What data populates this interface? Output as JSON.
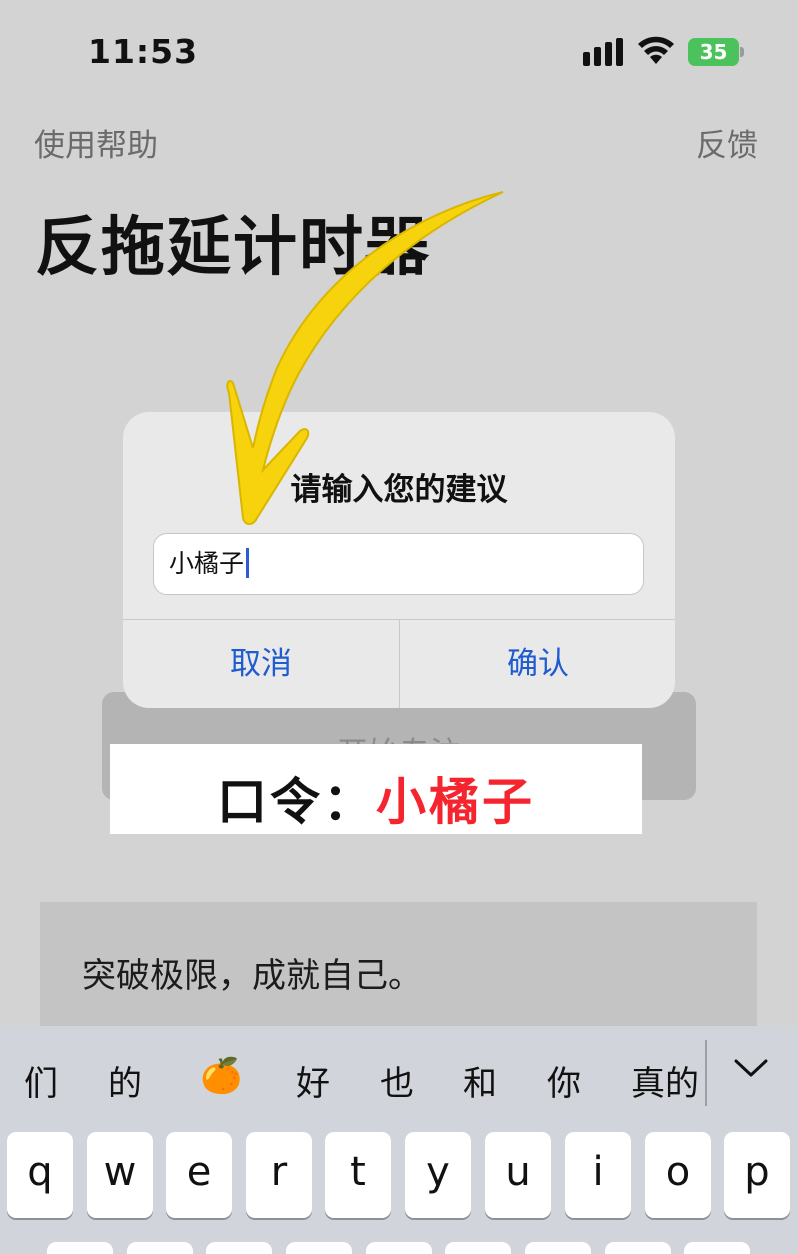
{
  "status_bar": {
    "time": "11:53",
    "battery": "35"
  },
  "nav": {
    "left": "使用帮助",
    "right": "反馈"
  },
  "page_title": "反拖延计时器",
  "start_button": {
    "label": "开始专注"
  },
  "quote": "突破极限，成就自己。",
  "dialog": {
    "title": "请输入您的建议",
    "input_value": "小橘子",
    "cancel": "取消",
    "confirm": "确认"
  },
  "banner": {
    "label": "口令：",
    "value": "小橘子"
  },
  "keyboard": {
    "candidates": [
      "们",
      "的",
      "🍊",
      "好",
      "也",
      "和",
      "你",
      "真的"
    ],
    "row1": [
      "q",
      "w",
      "e",
      "r",
      "t",
      "y",
      "u",
      "i",
      "o",
      "p"
    ]
  },
  "colors": {
    "arrow": "#f6d30d",
    "accent": "#1f5cd1",
    "banner_value": "#f4252e",
    "battery": "#4bc25b"
  }
}
